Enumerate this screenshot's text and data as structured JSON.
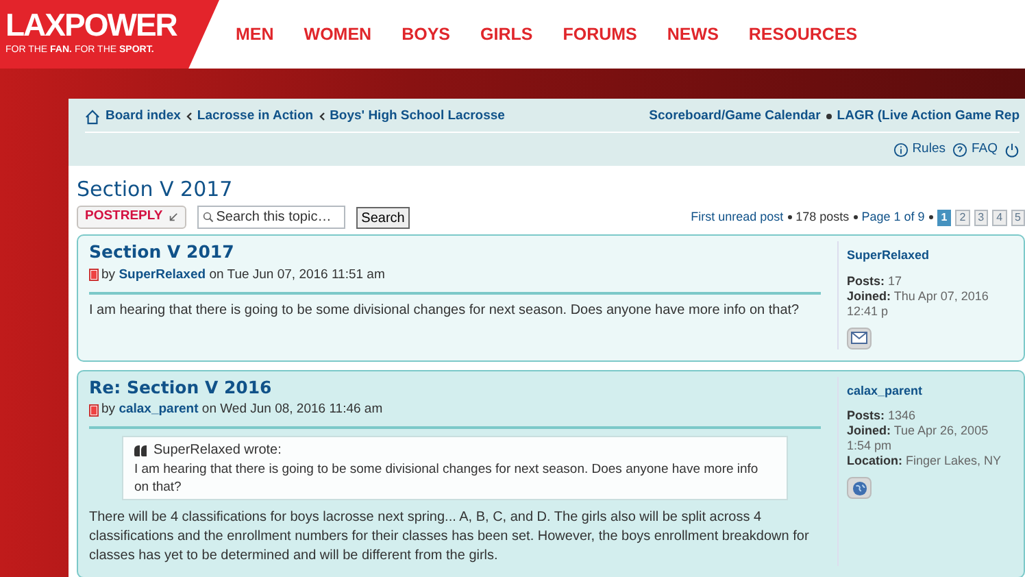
{
  "header": {
    "logo": "LAXPOWER",
    "tagline": "FOR THE **FAN.** FOR THE **SPORT.**",
    "nav": [
      "MEN",
      "WOMEN",
      "BOYS",
      "GIRLS",
      "FORUMS",
      "NEWS",
      "RESOURCES"
    ]
  },
  "breadcrumbs": [
    "Board index",
    "Lacrosse in Action",
    "Boys' High School Lacrosse"
  ],
  "quick_links": [
    "Scoreboard/Game Calendar",
    "LAGR (Live Action Game Rep"
  ],
  "header_links": [
    "Rules",
    "FAQ"
  ],
  "topic": {
    "title": "Section V 2017",
    "post_reply": "POSTREPLY",
    "search": {
      "placeholder": "Search this topic…"
    },
    "search_button": "Search",
    "first_unread": "First unread post",
    "post_count": "178 posts",
    "page_label": "Page 1 of 9",
    "pages": [
      {
        "label": "1",
        "selected": true
      },
      {
        "label": "2",
        "selected": false
      },
      {
        "label": "3",
        "selected": false
      },
      {
        "label": "4",
        "selected": false
      },
      {
        "label": "5",
        "selected": false
      }
    ]
  },
  "posts": [
    {
      "title": "Section V 2017",
      "by": "by",
      "author": "SuperRelaxed",
      "date": "on Tue Jun 07, 2016 11:51 am",
      "body": [
        "I am hearing that there is going to be some divisional changes for next season. Does anyone have more info on that?"
      ],
      "profile": {
        "name": "SuperRelaxed",
        "fields": [
          {
            "label": "Posts:",
            "value": "17"
          },
          {
            "label": "Joined:",
            "value": "Thu Apr 07, 2016 12:41 p"
          }
        ],
        "contact": {
          "kind": "email"
        }
      }
    },
    {
      "title": "Re: Section V 2016",
      "by": "by",
      "author": "calax_parent",
      "date": "on Wed Jun 08, 2016 11:46 am",
      "quote": {
        "author": "SuperRelaxed wrote:",
        "text": "I am hearing that there is going to be some divisional changes for next season. Does anyone have more info on that?"
      },
      "body": [
        "There will be 4 classifications for boys lacrosse next spring... A, B, C, and D. The girls also will be split across 4 classifications and the enrollment numbers for their classes has been set. However, the boys enrollment breakdown for classes has yet to be determined and will be different from the girls."
      ],
      "profile": {
        "name": "calax_parent",
        "fields": [
          {
            "label": "Posts:",
            "value": "1346"
          },
          {
            "label": "Joined:",
            "value": "Tue Apr 26, 2005 1:54 pm"
          },
          {
            "label": "Location:",
            "value": "Finger Lakes, NY"
          }
        ],
        "contact": {
          "kind": "website"
        }
      }
    }
  ]
}
